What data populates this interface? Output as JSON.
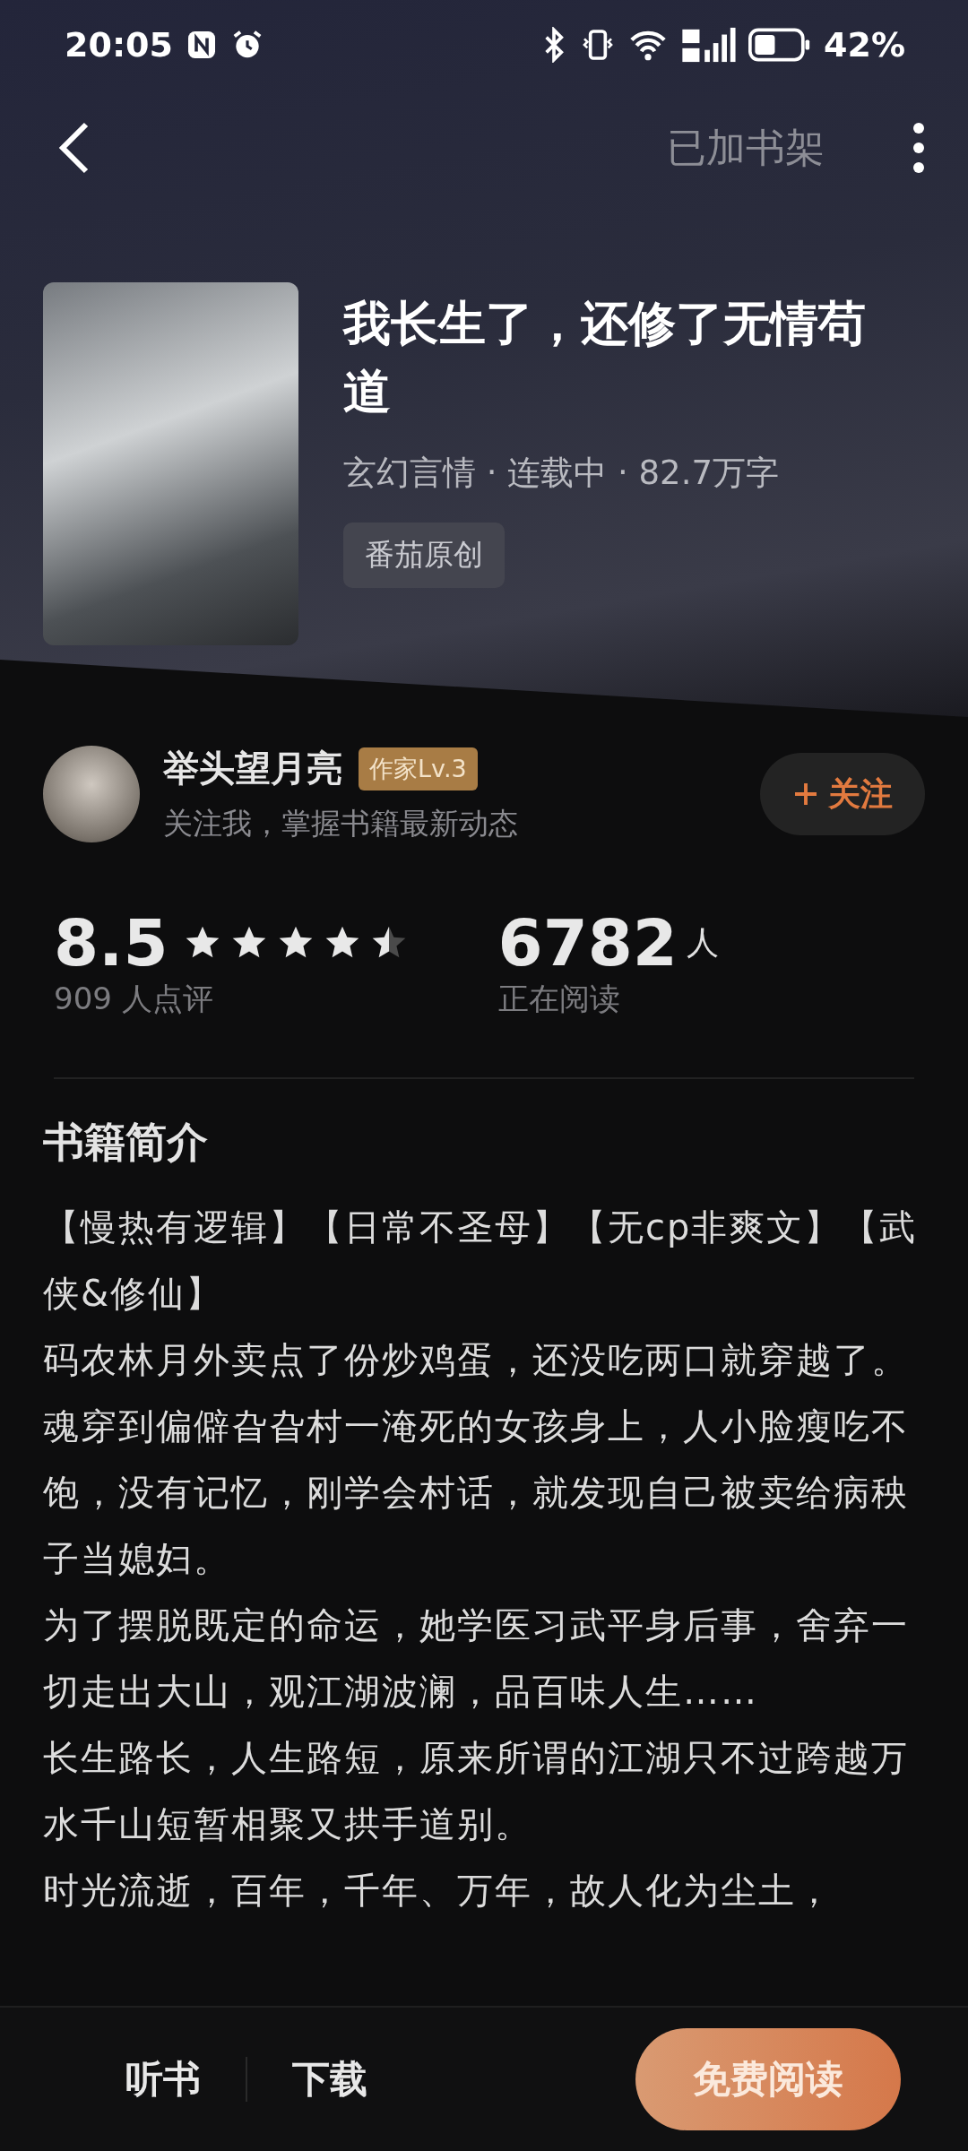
{
  "status_bar": {
    "time": "20:05",
    "battery": "42%"
  },
  "top_bar": {
    "shelf_status": "已加书架"
  },
  "book": {
    "title": "我长生了，还修了无情苟道",
    "meta": "玄幻言情 · 连载中 · 82.7万字",
    "tag": "番茄原创"
  },
  "author": {
    "name": "举头望月亮",
    "level": "作家Lv.3",
    "tagline": "关注我，掌握书籍最新动态",
    "follow_label": "关注",
    "followed": false
  },
  "stats": {
    "score": "8.5",
    "stars": 4.5,
    "reviews": "909 人点评",
    "readers": "6782",
    "readers_unit": "人",
    "readers_label": "正在阅读"
  },
  "intro": {
    "heading": "书籍简介",
    "paragraphs": [
      "【慢热有逻辑】【日常不圣母】【无cp非爽文】【武侠&修仙】",
      "码农林月外卖点了份炒鸡蛋，还没吃两口就穿越了。",
      "魂穿到偏僻旮旮村一淹死的女孩身上，人小脸瘦吃不饱，没有记忆，刚学会村话，就发现自己被卖给病秧子当媳妇。",
      "为了摆脱既定的命运，她学医习武平身后事，舍弃一切走出大山，观江湖波澜，品百味人生……",
      "长生路长，人生路短，原来所谓的江湖只不过跨越万水千山短暂相聚又拱手道别。",
      "时光流逝，百年，千年、万年，故人化为尘土，"
    ]
  },
  "bottom_bar": {
    "listen": "听书",
    "download": "下载",
    "read": "免费阅读"
  }
}
